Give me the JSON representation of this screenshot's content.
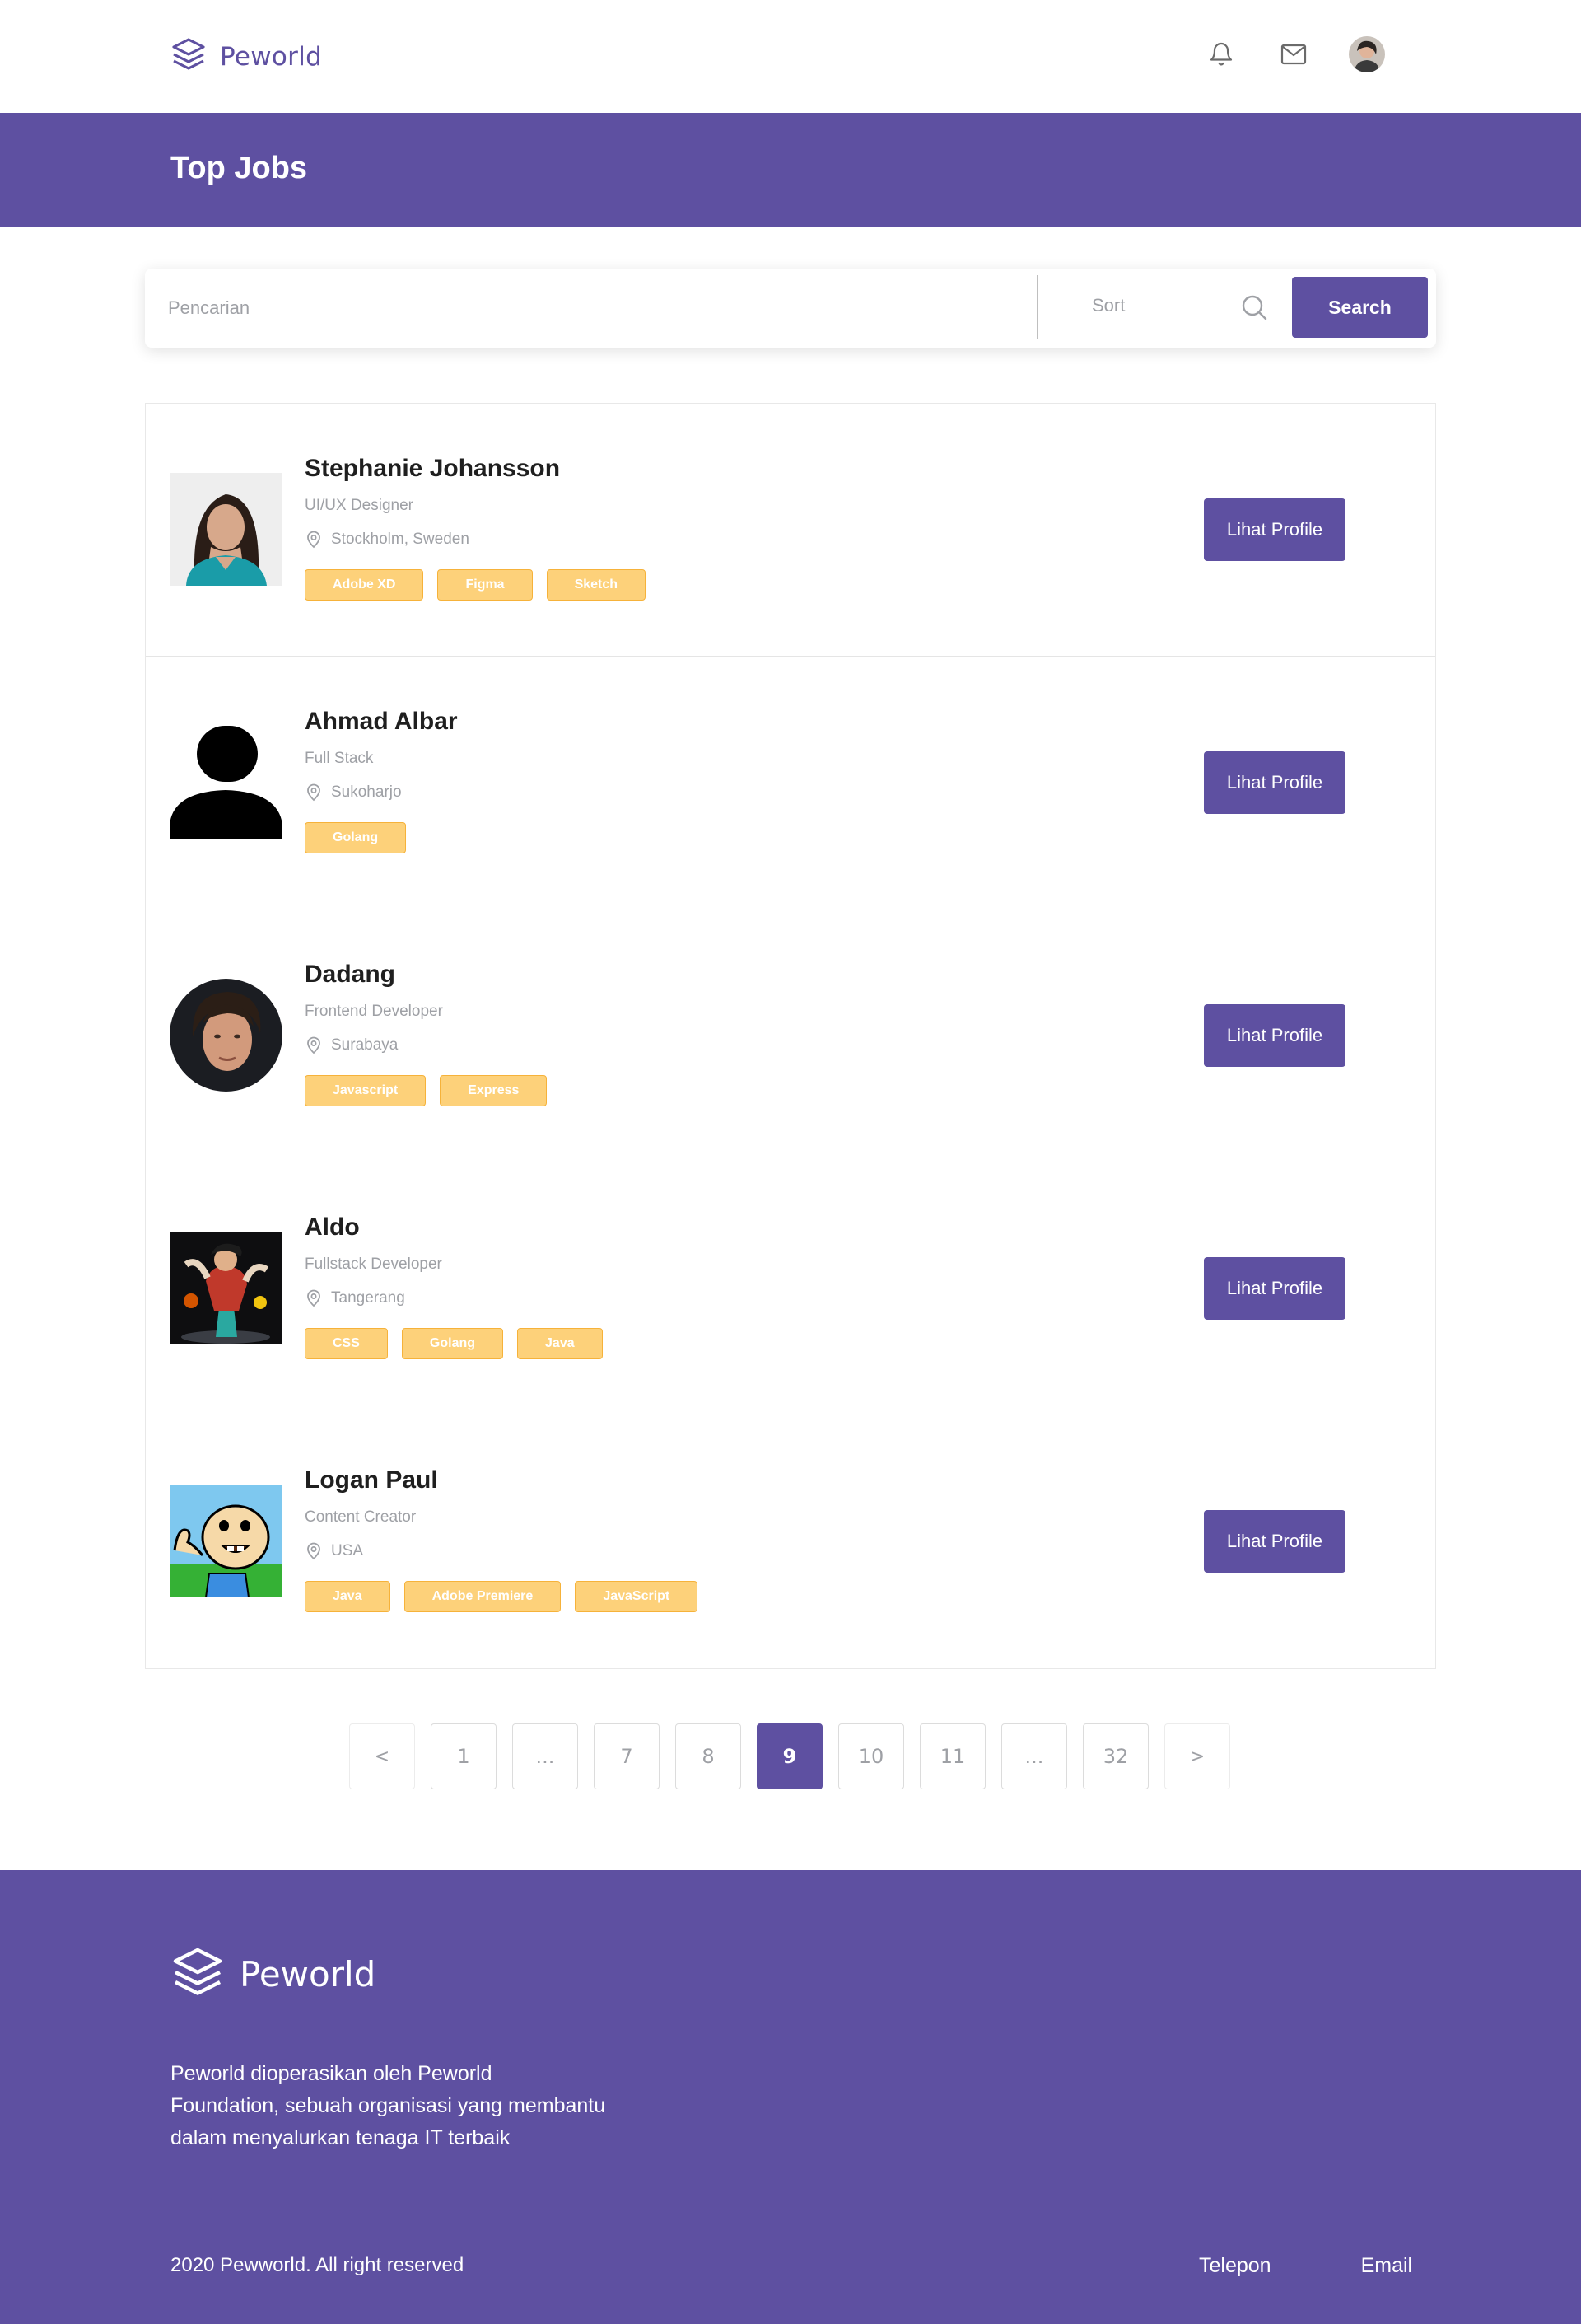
{
  "brand": {
    "name": "Peworld",
    "primary_color": "#5e50a1",
    "tag_color": "#fdd17a"
  },
  "nav": {
    "icons": [
      "bell-icon",
      "mail-icon"
    ],
    "avatar": "user-avatar"
  },
  "hero": {
    "title": "Top Jobs"
  },
  "search": {
    "placeholder": "Pencarian",
    "value": "",
    "sort_label": "Sort",
    "button_label": "Search"
  },
  "candidates": [
    {
      "name": "Stephanie Johansson",
      "role": "UI/UX Designer",
      "location": "Stockholm, Sweden",
      "skills": [
        "Adobe XD",
        "Figma",
        "Sketch"
      ],
      "button": "Lihat Profile"
    },
    {
      "name": "Ahmad Albar",
      "role": "Full Stack",
      "location": "Sukoharjo",
      "skills": [
        "Golang"
      ],
      "button": "Lihat Profile"
    },
    {
      "name": "Dadang",
      "role": "Frontend Developer",
      "location": "Surabaya",
      "skills": [
        "Javascript",
        "Express"
      ],
      "button": "Lihat Profile"
    },
    {
      "name": "Aldo",
      "role": "Fullstack Developer",
      "location": "Tangerang",
      "skills": [
        "CSS",
        "Golang",
        "Java"
      ],
      "button": "Lihat Profile"
    },
    {
      "name": "Logan Paul",
      "role": "Content Creator",
      "location": "USA",
      "skills": [
        "Java",
        "Adobe Premiere",
        "JavaScript"
      ],
      "button": "Lihat Profile"
    }
  ],
  "pagination": {
    "prev": "<",
    "pages": [
      "1",
      "...",
      "7",
      "8",
      "9",
      "10",
      "11",
      "...",
      "32"
    ],
    "current": "9",
    "next": ">"
  },
  "footer": {
    "brand": "Peworld",
    "description_lines": [
      "Peworld dioperasikan oleh Peworld",
      "Foundation, sebuah organisasi yang membantu",
      "dalam menyalurkan tenaga IT terbaik"
    ],
    "copyright": "2020 Pewworld. All right reserved",
    "links": [
      "Telepon",
      "Email"
    ]
  }
}
